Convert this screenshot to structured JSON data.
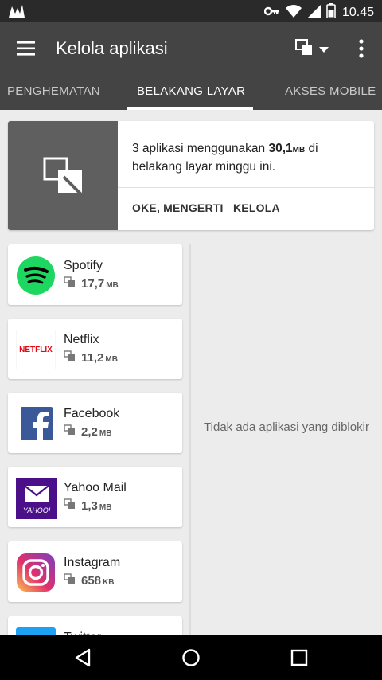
{
  "status_bar": {
    "time": "10.45"
  },
  "app_bar": {
    "title": "Kelola aplikasi"
  },
  "tabs": [
    {
      "label": "PENGHEMATAN"
    },
    {
      "label": "BELAKANG LAYAR"
    },
    {
      "label": "AKSES MOBILE"
    }
  ],
  "info_card": {
    "prefix": "3 aplikasi menggunakan ",
    "amount": "30,1",
    "unit": "MB",
    "suffix": " di belakang layar minggu ini.",
    "ok_label": "OKE, MENGERTI",
    "manage_label": "KELOLA"
  },
  "apps": [
    {
      "name": "Spotify",
      "usage": "17,7",
      "unit": "MB"
    },
    {
      "name": "Netflix",
      "usage": "11,2",
      "unit": "MB"
    },
    {
      "name": "Facebook",
      "usage": "2,2",
      "unit": "MB"
    },
    {
      "name": "Yahoo Mail",
      "usage": "1,3",
      "unit": "MB"
    },
    {
      "name": "Instagram",
      "usage": "658",
      "unit": "KB"
    },
    {
      "name": "Twitter"
    }
  ],
  "logos": {
    "netflix": "NETFLIX",
    "yahoo": "YAHOO!"
  },
  "blocked_panel": {
    "empty_message": "Tidak ada aplikasi yang diblokir"
  },
  "colors": {
    "app_bar": "#444444",
    "spotify": "#1ed760",
    "netflix": "#e50914",
    "facebook": "#3b5998",
    "yahoo": "#4b0f8a",
    "twitter": "#1da1f2"
  }
}
